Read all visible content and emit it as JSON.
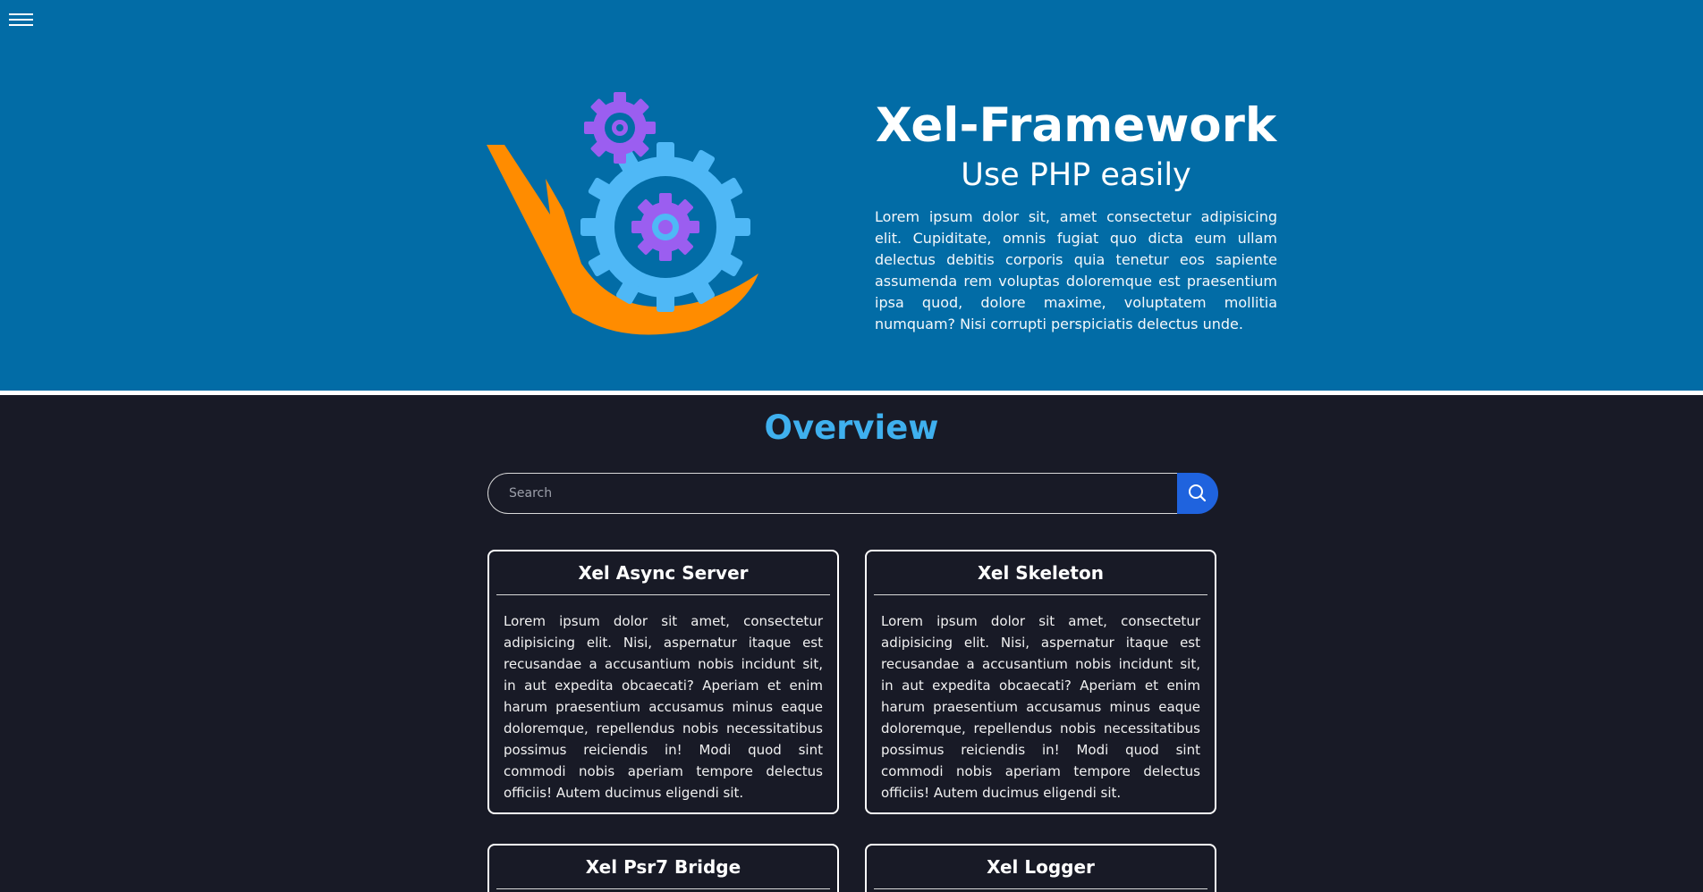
{
  "header": {
    "menu_icon": "hamburger-menu-icon",
    "title": "Xel-Framework",
    "subtitle": "Use PHP easily",
    "description": "Lorem ipsum dolor sit, amet consectetur adipisicing elit. Cupiditate, omnis fugiat quo dicta eum ullam delectus debitis corporis quia tenetur eos sapiente assumenda rem voluptas doloremque est praesentium ipsa quod, dolore maxime, voluptatem mollitia numquam? Nisi corrupti perspiciatis delectus unde.",
    "logo_icon": "gears-logo-icon"
  },
  "overview": {
    "title": "Overview",
    "search": {
      "placeholder": "Search",
      "value": "",
      "button_icon": "search-icon"
    },
    "cards": [
      {
        "title": "Xel Async Server",
        "body": "Lorem ipsum dolor sit amet, consectetur adipisicing elit. Nisi, aspernatur itaque est recusandae a accusantium nobis incidunt sit, in aut expedita obcaecati? Aperiam et enim harum praesentium accusamus minus eaque doloremque, repellendus nobis necessitatibus possimus reiciendis in! Modi quod sint commodi nobis aperiam tempore delectus officiis! Autem ducimus eligendi sit."
      },
      {
        "title": "Xel Skeleton",
        "body": "Lorem ipsum dolor sit amet, consectetur adipisicing elit. Nisi, aspernatur itaque est recusandae a accusantium nobis incidunt sit, in aut expedita obcaecati? Aperiam et enim harum praesentium accusamus minus eaque doloremque, repellendus nobis necessitatibus possimus reiciendis in! Modi quod sint commodi nobis aperiam tempore delectus officiis! Autem ducimus eligendi sit."
      },
      {
        "title": "Xel Psr7 Bridge",
        "body": ""
      },
      {
        "title": "Xel Logger",
        "body": ""
      }
    ]
  },
  "colors": {
    "hero_bg": "#026ca6",
    "page_bg": "#181a26",
    "accent_title": "#3fb0ee",
    "search_button": "#1f63de",
    "logo_orange": "#ff8c00",
    "logo_blue": "#4fb8f6",
    "logo_purple": "#9b5ef0"
  }
}
